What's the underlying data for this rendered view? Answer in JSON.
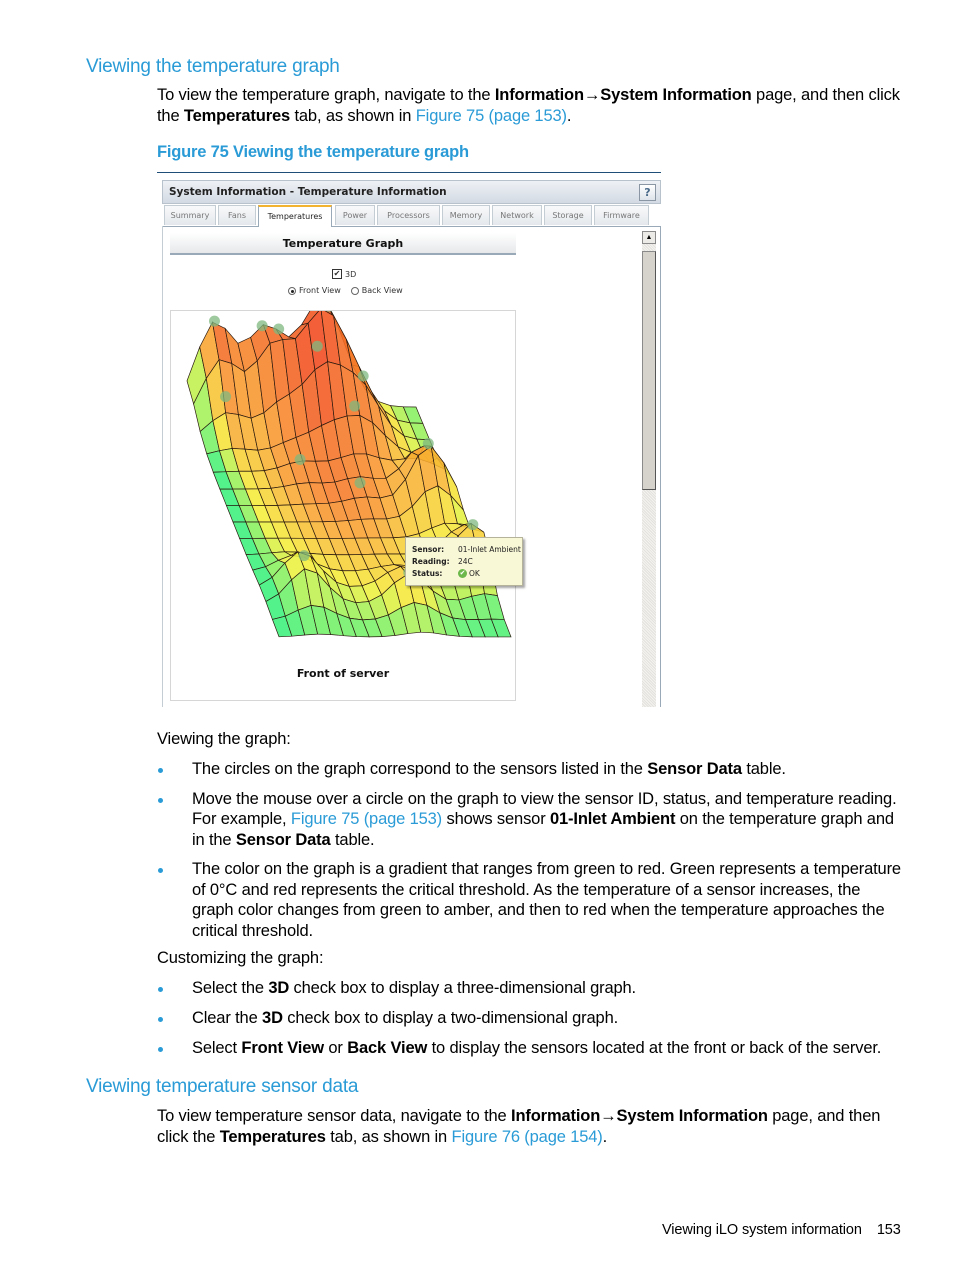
{
  "section1": {
    "heading": "Viewing the temperature graph",
    "intro": {
      "t1": "To view the temperature graph, navigate to the ",
      "b1": "Information",
      "arrow": "→",
      "b2": "System Information",
      "t2": " page, and then click the ",
      "b3": "Temperatures",
      "t3": " tab, as shown in ",
      "link": "Figure 75 (page 153)",
      "t4": "."
    },
    "figure_caption": "Figure 75 Viewing the temperature graph"
  },
  "screenshot": {
    "title": "System Information - Temperature Information",
    "help_label": "?",
    "tabs": [
      {
        "label": "Summary",
        "active": false
      },
      {
        "label": "Fans",
        "active": false
      },
      {
        "label": "Temperatures",
        "active": true
      },
      {
        "label": "Power",
        "active": false
      },
      {
        "label": "Processors",
        "active": false
      },
      {
        "label": "Memory",
        "active": false
      },
      {
        "label": "Network",
        "active": false
      },
      {
        "label": "Storage",
        "active": false
      },
      {
        "label": "Firmware",
        "active": false
      }
    ],
    "panel_title": "Temperature Graph",
    "option_3d": {
      "label": "3D",
      "checked": true,
      "check_glyph": "✔"
    },
    "views": [
      {
        "label": "Front View",
        "selected": true
      },
      {
        "label": "Back View",
        "selected": false
      }
    ],
    "graph_caption": "Front of server",
    "tooltip": {
      "sensor_label": "Sensor:",
      "sensor_value": "01-Inlet Ambient",
      "reading_label": "Reading:",
      "reading_value": "24C",
      "status_label": "Status:",
      "status_value": "OK",
      "status_icon": "✔"
    },
    "scroll_up_glyph": "▲",
    "colors": {
      "low": "#3cf07a",
      "mid": "#f5f03a",
      "amber": "#f9a030",
      "high": "#f0401a",
      "sensor_marker": "#7fb87f"
    }
  },
  "section1_body": {
    "viewing_intro": "Viewing the graph:",
    "bullets": [
      {
        "t1": "The circles on the graph correspond to the sensors listed in the ",
        "b1": "Sensor Data",
        "t2": " table."
      },
      {
        "t1": "Move the mouse over a circle on the graph to view the sensor ID, status, and temperature reading. For example, ",
        "link": "Figure 75 (page 153)",
        "t2": " shows sensor ",
        "b1": "01-Inlet Ambient",
        "t3": " on the temperature graph and in the ",
        "b2": "Sensor Data",
        "t4": " table."
      },
      {
        "t1": "The color on the graph is a gradient that ranges from green to red. Green represents a temperature of 0°C and red represents the critical threshold. As the temperature of a sensor increases, the graph color changes from green to amber, and then to red when the temperature approaches the critical threshold."
      }
    ],
    "customizing_intro": "Customizing the graph:",
    "custom_bullets": [
      {
        "t1": "Select the ",
        "b1": "3D",
        "t2": " check box to display a three-dimensional graph."
      },
      {
        "t1": "Clear the ",
        "b1": "3D",
        "t2": " check box to display a two-dimensional graph."
      },
      {
        "t1": "Select ",
        "b1": "Front View",
        "t2": " or ",
        "b2": "Back View",
        "t3": " to display the sensors located at the front or back of the server."
      }
    ]
  },
  "section2": {
    "heading": "Viewing temperature sensor data",
    "intro": {
      "t1": "To view temperature sensor data, navigate to the ",
      "b1": "Information",
      "arrow": "→",
      "b2": "System Information",
      "t2": " page, and then click the ",
      "b3": "Temperatures",
      "t3": " tab, as shown in ",
      "link": "Figure 76 (page 154)",
      "t4": "."
    }
  },
  "footer": {
    "section": "Viewing iLO system information",
    "page": "153"
  }
}
